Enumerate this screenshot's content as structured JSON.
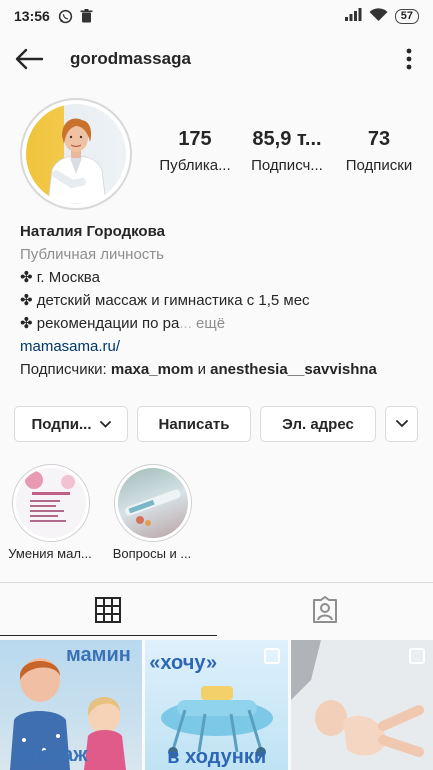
{
  "status_bar": {
    "time": "13:56",
    "battery": "57"
  },
  "header": {
    "username": "gorodmassaga"
  },
  "profile": {
    "stats": [
      {
        "value": "175",
        "label": "Публика..."
      },
      {
        "value": "85,9 т...",
        "label": "Подписч..."
      },
      {
        "value": "73",
        "label": "Подписки"
      }
    ],
    "name": "Наталия Городкова",
    "category": "Публичная личность",
    "bio_line1": "✤ г. Москва",
    "bio_line2": "✤ детский массаж и гимнастика с 1,5 мес",
    "bio_line3_main": "✤ рекомендации по ра",
    "bio_line3_faded": "...",
    "bio_more": " ещё",
    "website": "mamasama.ru/",
    "followed_by_prefix": "Подписчики: ",
    "followed_by_user1": "maxa_mom",
    "followed_by_and": " и ",
    "followed_by_user2": "anesthesia__savvishna"
  },
  "actions": {
    "follow_label": "Подпи...",
    "message_label": "Написать",
    "email_label": "Эл. адрес"
  },
  "highlights": [
    {
      "label": "Умения мал..."
    },
    {
      "label": "Вопросы и ..."
    }
  ],
  "posts": [
    {
      "overlay_top": "мамин",
      "overlay_bottom": "массаж"
    },
    {
      "overlay_top": "«хочу»",
      "overlay_bottom": "в ходунки"
    },
    {
      "overlay_top": "",
      "overlay_bottom": ""
    }
  ],
  "colors": {
    "link": "#00376b",
    "secondary_text": "#8e8e8e",
    "border": "#dbdbdb",
    "post_text_blue": "#3a72b8"
  },
  "icons": {
    "back": "arrow-left-icon",
    "more": "more-vertical-icon",
    "grid": "grid-icon",
    "tagged": "tagged-person-icon",
    "dropdown": "chevron-down-icon"
  }
}
